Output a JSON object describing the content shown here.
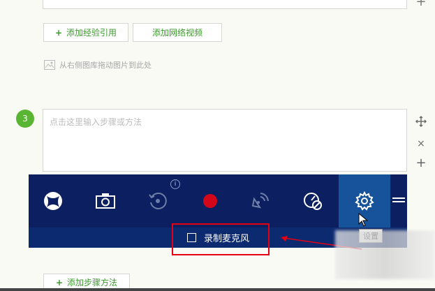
{
  "toolbar_top": {
    "add_reference_label": "添加经验引用",
    "add_video_label": "添加网络视频",
    "image_hint": "从右侧图库拖动图片到此处"
  },
  "step": {
    "number": "3",
    "placeholder": "点击这里输入步骤或方法"
  },
  "gamebar": {
    "items": [
      "xbox-icon",
      "camera-icon",
      "recent-record-icon",
      "record-icon",
      "broadcast-icon",
      "performance-icon",
      "settings-icon"
    ],
    "record_mic_label": "录制麦克风",
    "tooltip": "设置",
    "accent": "#16539b",
    "background": "#0b1f61",
    "record_color": "#d3061a"
  },
  "bottom": {
    "add_step_label": "添加步骤方法"
  },
  "colors": {
    "green": "#3a9a2a",
    "annotation_red": "#e60012"
  }
}
